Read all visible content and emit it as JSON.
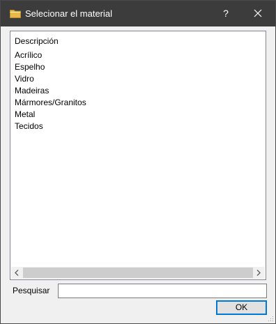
{
  "window": {
    "title": "Selecionar el material",
    "help_label": "?",
    "icons": {
      "title": "folder-icon",
      "close": "close-icon",
      "grip": "resize-grip-icon"
    }
  },
  "list": {
    "column_header": "Descripción",
    "items": [
      "Acrílico",
      "Espelho",
      "Vidro",
      "Madeiras",
      "Mármores/Granitos",
      "Metal",
      "Tecidos"
    ]
  },
  "search": {
    "label": "Pesquisar",
    "value": "",
    "placeholder": ""
  },
  "buttons": {
    "ok_label": "OK"
  },
  "colors": {
    "titlebar": "#3c3c3c",
    "accent": "#0078d7",
    "folder": "#e8b84a"
  }
}
